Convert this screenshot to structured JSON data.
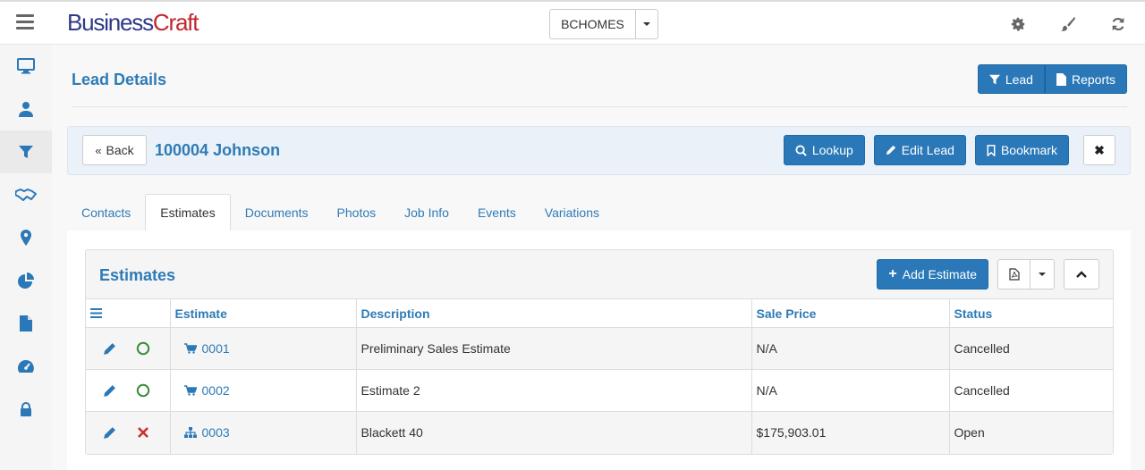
{
  "app": {
    "logo_part1": "Business",
    "logo_part2": "Craft",
    "company": "BCHOMES"
  },
  "colors": {
    "accent": "#2a78b7",
    "link": "#2e7bb6",
    "logo_blue": "#2e3a87",
    "logo_red": "#c0272d",
    "ok_green": "#3c8c3c",
    "cancel_red": "#c9302c"
  },
  "sidebar": {
    "items": [
      {
        "icon": "desktop-icon"
      },
      {
        "icon": "user-icon"
      },
      {
        "icon": "filter-icon",
        "active": true
      },
      {
        "icon": "handshake-icon"
      },
      {
        "icon": "map-marker-icon"
      },
      {
        "icon": "pie-chart-icon"
      },
      {
        "icon": "file-icon"
      },
      {
        "icon": "dashboard-icon"
      },
      {
        "icon": "lock-icon"
      }
    ]
  },
  "header": {
    "title": "Lead Details",
    "lead_button": "Lead",
    "reports_button": "Reports"
  },
  "lead": {
    "back_label": "Back",
    "name": "100004 Johnson",
    "lookup_label": "Lookup",
    "edit_label": "Edit Lead",
    "bookmark_label": "Bookmark"
  },
  "tabs": [
    {
      "label": "Contacts",
      "active": false
    },
    {
      "label": "Estimates",
      "active": true
    },
    {
      "label": "Documents",
      "active": false
    },
    {
      "label": "Photos",
      "active": false
    },
    {
      "label": "Job Info",
      "active": false
    },
    {
      "label": "Events",
      "active": false
    },
    {
      "label": "Variations",
      "active": false
    }
  ],
  "estimates": {
    "title": "Estimates",
    "add_label": "Add Estimate",
    "columns": {
      "estimate": "Estimate",
      "description": "Description",
      "sale_price": "Sale Price",
      "status": "Status"
    },
    "rows": [
      {
        "estimate": "0001",
        "type": "cart",
        "state": "ok",
        "description": "Preliminary Sales Estimate",
        "sale_price": "N/A",
        "status": "Cancelled"
      },
      {
        "estimate": "0002",
        "type": "cart",
        "state": "ok",
        "description": "Estimate 2",
        "sale_price": "N/A",
        "status": "Cancelled"
      },
      {
        "estimate": "0003",
        "type": "sitemap",
        "state": "x",
        "description": "Blackett 40",
        "sale_price": "$175,903.01",
        "status": "Open"
      }
    ]
  }
}
